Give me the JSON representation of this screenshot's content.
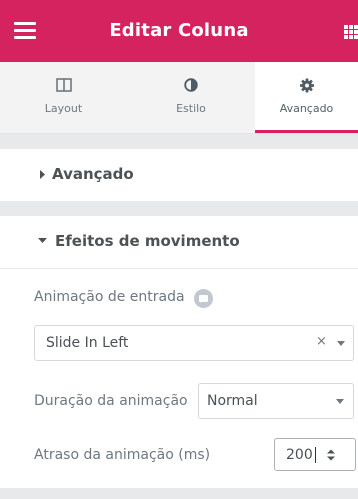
{
  "header": {
    "title": "Editar Coluna",
    "menu_icon": "hamburger-menu-icon",
    "grid_icon": "apps-grid-icon",
    "color": "#d5235f"
  },
  "tabs": [
    {
      "label": "Layout",
      "icon": "columns-icon",
      "active": false
    },
    {
      "label": "Estilo",
      "icon": "contrast-icon",
      "active": false
    },
    {
      "label": "Avançado",
      "icon": "gear-icon",
      "active": true
    }
  ],
  "sections": {
    "advanced": {
      "title": "Avançado",
      "expanded": false
    },
    "motion": {
      "title": "Efeitos de movimento",
      "expanded": true
    }
  },
  "motion": {
    "entrance_label": "Animação de entrada",
    "entrance_value": "Slide In Left",
    "clear_symbol": "×",
    "duration_label": "Duração da animação",
    "duration_value": "Normal",
    "delay_label": "Atraso da animação (ms)",
    "delay_value": "200"
  }
}
